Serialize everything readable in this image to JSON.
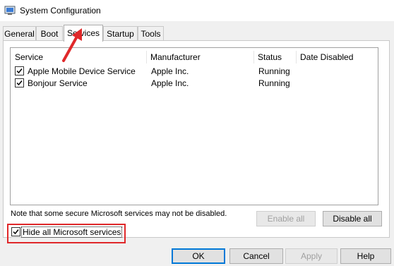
{
  "window": {
    "title": "System Configuration",
    "icon": "msconfig-icon"
  },
  "tabs": [
    {
      "label": "General"
    },
    {
      "label": "Boot"
    },
    {
      "label": "Services",
      "active": true
    },
    {
      "label": "Startup"
    },
    {
      "label": "Tools"
    }
  ],
  "services_table": {
    "columns": [
      "Service",
      "Manufacturer",
      "Status",
      "Date Disabled"
    ],
    "rows": [
      {
        "checked": true,
        "service": "Apple Mobile Device Service",
        "manufacturer": "Apple Inc.",
        "status": "Running",
        "date_disabled": ""
      },
      {
        "checked": true,
        "service": "Bonjour Service",
        "manufacturer": "Apple Inc.",
        "status": "Running",
        "date_disabled": ""
      }
    ]
  },
  "note": "Note that some secure Microsoft services may not be disabled.",
  "buttons": {
    "enable_all": "Enable all",
    "disable_all": "Disable all",
    "ok": "OK",
    "cancel": "Cancel",
    "apply": "Apply",
    "help": "Help"
  },
  "hide_ms_services": {
    "label": "Hide all Microsoft services",
    "checked": true
  },
  "annotations": {
    "highlight_color": "#e0282a"
  }
}
